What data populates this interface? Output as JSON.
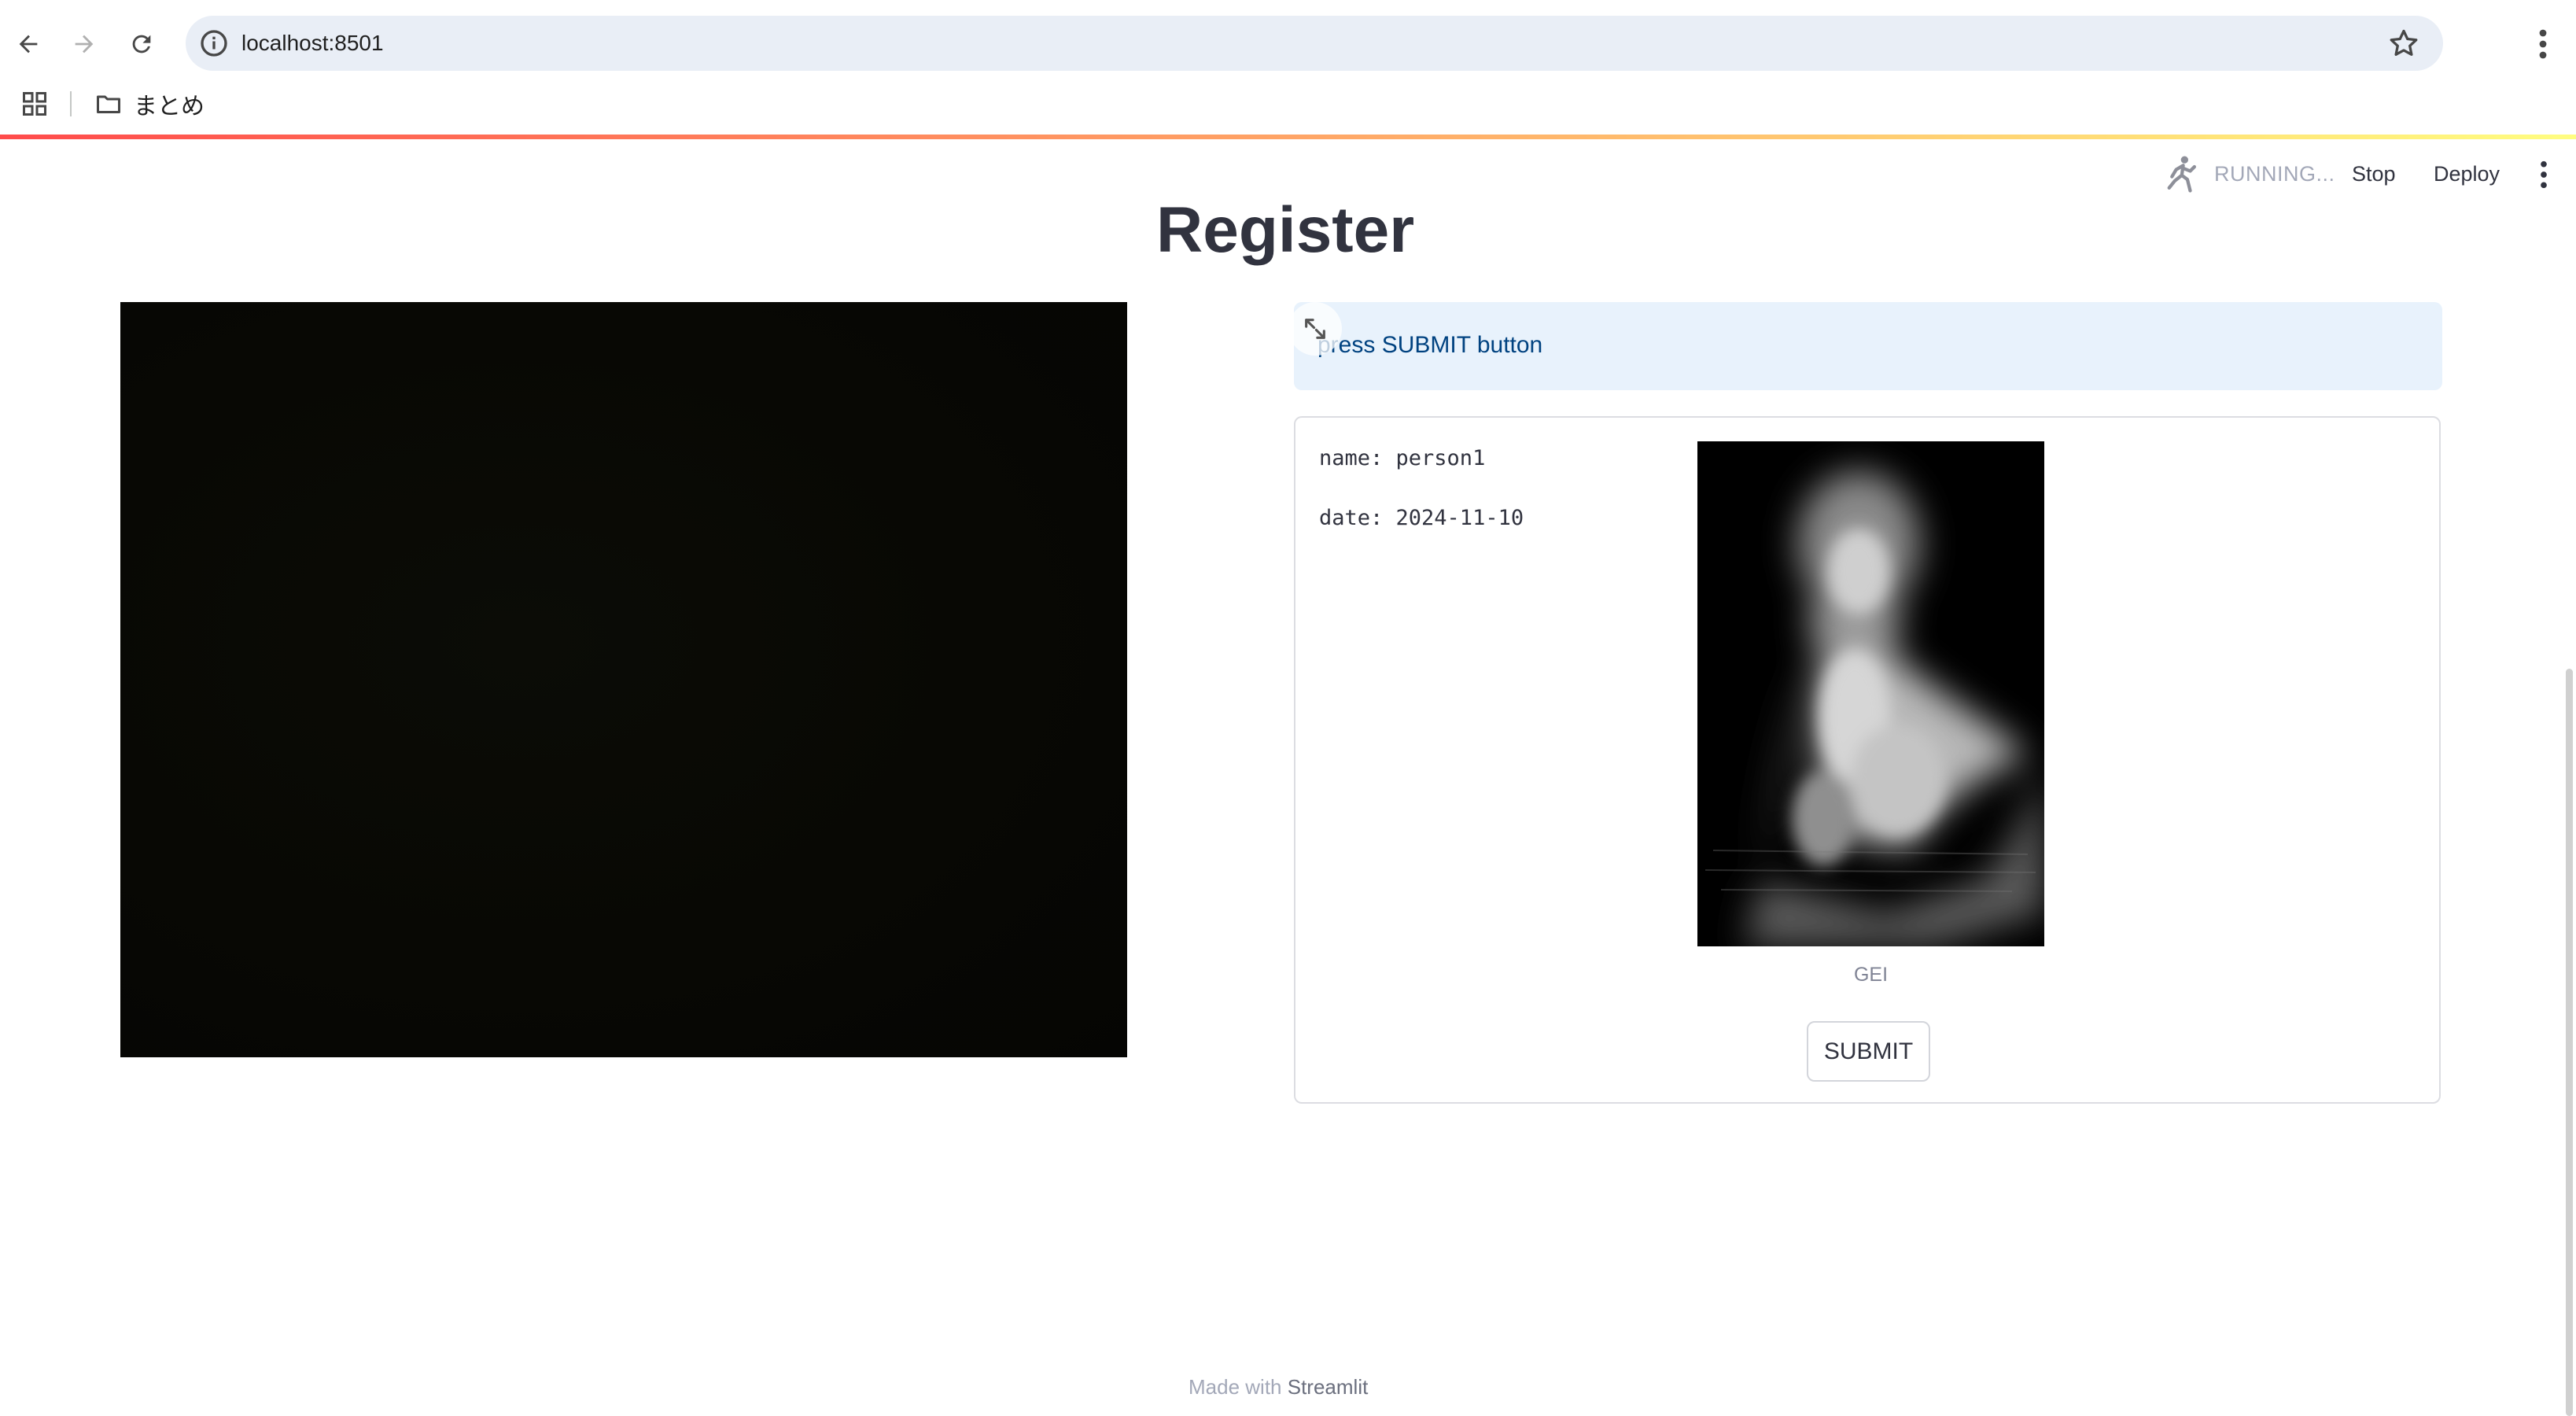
{
  "browser": {
    "url": "localhost:8501",
    "bookmark_folder": "まとめ"
  },
  "app_header": {
    "status": "RUNNING...",
    "stop_label": "Stop",
    "deploy_label": "Deploy"
  },
  "page": {
    "title": "Register"
  },
  "info_alert": {
    "text": "press SUBMIT button"
  },
  "form": {
    "name_line": "name: person1",
    "date_line": "date: 2024-11-10",
    "image_caption": "GEI",
    "submit_label": "SUBMIT"
  },
  "footer": {
    "prefix": "Made with ",
    "link": "Streamlit"
  },
  "colors": {
    "accent_gradient_start": "#ff4b4b",
    "accent_gradient_end": "#fffd80",
    "info_background": "#e8f2fc",
    "info_text": "#004280"
  },
  "icons": [
    "back-arrow-icon",
    "forward-arrow-icon",
    "reload-icon",
    "site-info-icon",
    "star-icon",
    "kebab-menu-icon",
    "apps-grid-icon",
    "folder-icon",
    "running-figure-icon",
    "fullscreen-icon"
  ]
}
